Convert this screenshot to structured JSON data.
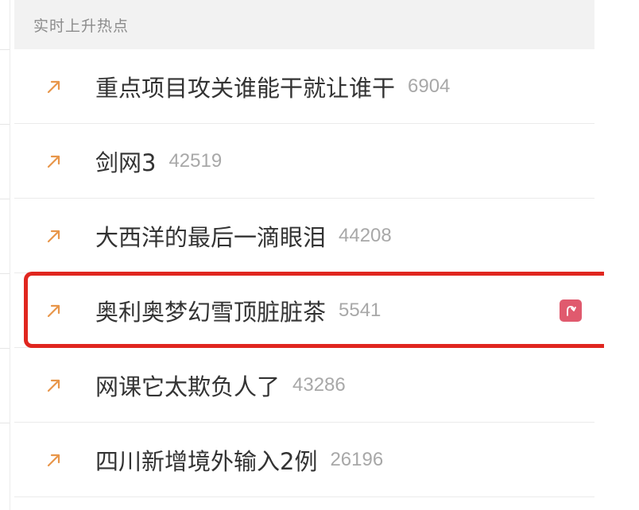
{
  "header": {
    "title": "实时上升热点"
  },
  "items": [
    {
      "title": "重点项目攻关谁能干就让谁干",
      "count": "6904"
    },
    {
      "title": "剑网3",
      "count": "42519"
    },
    {
      "title": "大西洋的最后一滴眼泪",
      "count": "44208"
    },
    {
      "title": "奥利奥梦幻雪顶脏脏茶",
      "count": "5541"
    },
    {
      "title": "网课它太欺负人了",
      "count": "43286"
    },
    {
      "title": "四川新增境外输入2例",
      "count": "26196"
    }
  ],
  "icons": {
    "trend": "rising-arrow-icon",
    "badge": "rising-badge-icon"
  },
  "colors": {
    "arrow": "#e8964a",
    "highlight_border": "#e0261f",
    "badge_bg": "#e05a6e",
    "header_bg": "#f2f2f2"
  }
}
